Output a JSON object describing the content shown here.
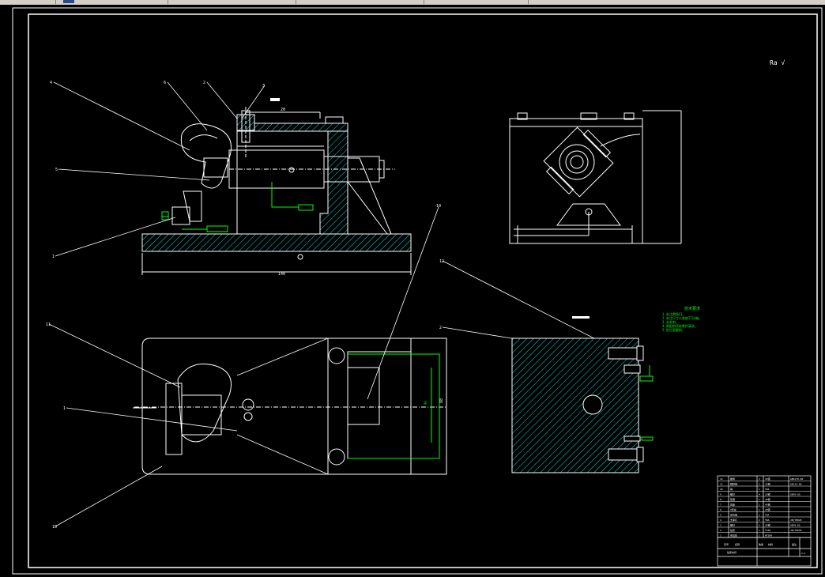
{
  "toolbar": {
    "tabs": [
      "",
      "",
      "",
      "",
      "",
      ""
    ]
  },
  "drawing": {
    "roughness_symbol": "Ra √",
    "part_numbers": [
      "4",
      "6",
      "2",
      "3",
      "5",
      "1",
      "11",
      "1",
      "10",
      "10",
      "12",
      "2",
      "4"
    ],
    "dimension_texts": [
      "20",
      "140",
      "96",
      "88"
    ],
    "notes_title": "技术要求",
    "notes": [
      "1.未注倒角C1。",
      "2.未注尺寸公差按IT14级。",
      "3.去毛刺。",
      "4.装配前所有零件清洗。",
      "5.定位面磨削。"
    ],
    "view_label_c": "C向"
  },
  "title_block": {
    "rows": [
      {
        "no": "12",
        "name": "螺母",
        "qty": "2",
        "mat": "45钢",
        "std": "GB6170-86"
      },
      {
        "no": "11",
        "name": "圆柱销",
        "qty": "2",
        "mat": "35钢",
        "std": "GB119-86"
      },
      {
        "no": "10",
        "name": "销",
        "qty": "1",
        "mat": "T8A",
        "std": ""
      },
      {
        "no": "9",
        "name": "螺钉",
        "qty": "4",
        "mat": "35钢",
        "std": "GB70-85"
      },
      {
        "no": "8",
        "name": "垫圈",
        "qty": "1",
        "mat": "45钢",
        "std": ""
      },
      {
        "no": "7",
        "name": "压板",
        "qty": "1",
        "mat": "45钢",
        "std": ""
      },
      {
        "no": "6",
        "name": "V形块",
        "qty": "1",
        "mat": "20钢",
        "std": ""
      },
      {
        "no": "5",
        "name": "定位销",
        "qty": "1",
        "mat": "T8A",
        "std": ""
      },
      {
        "no": "4",
        "name": "支承钉",
        "qty": "2",
        "mat": "T8A",
        "std": "JB/T8029"
      },
      {
        "no": "3",
        "name": "螺钉",
        "qty": "2",
        "mat": "35钢",
        "std": "GB70-85"
      },
      {
        "no": "2",
        "name": "钻套",
        "qty": "1",
        "mat": "T10A",
        "std": "JB/T8045"
      },
      {
        "no": "1",
        "name": "夹具体",
        "qty": "1",
        "mat": "HT200",
        "std": ""
      }
    ],
    "header": {
      "no": "序号",
      "name": "名称",
      "qty": "数量",
      "mat": "材料",
      "std": "备注"
    },
    "drawing_title": "钻床夹具",
    "scale": "1:1"
  }
}
